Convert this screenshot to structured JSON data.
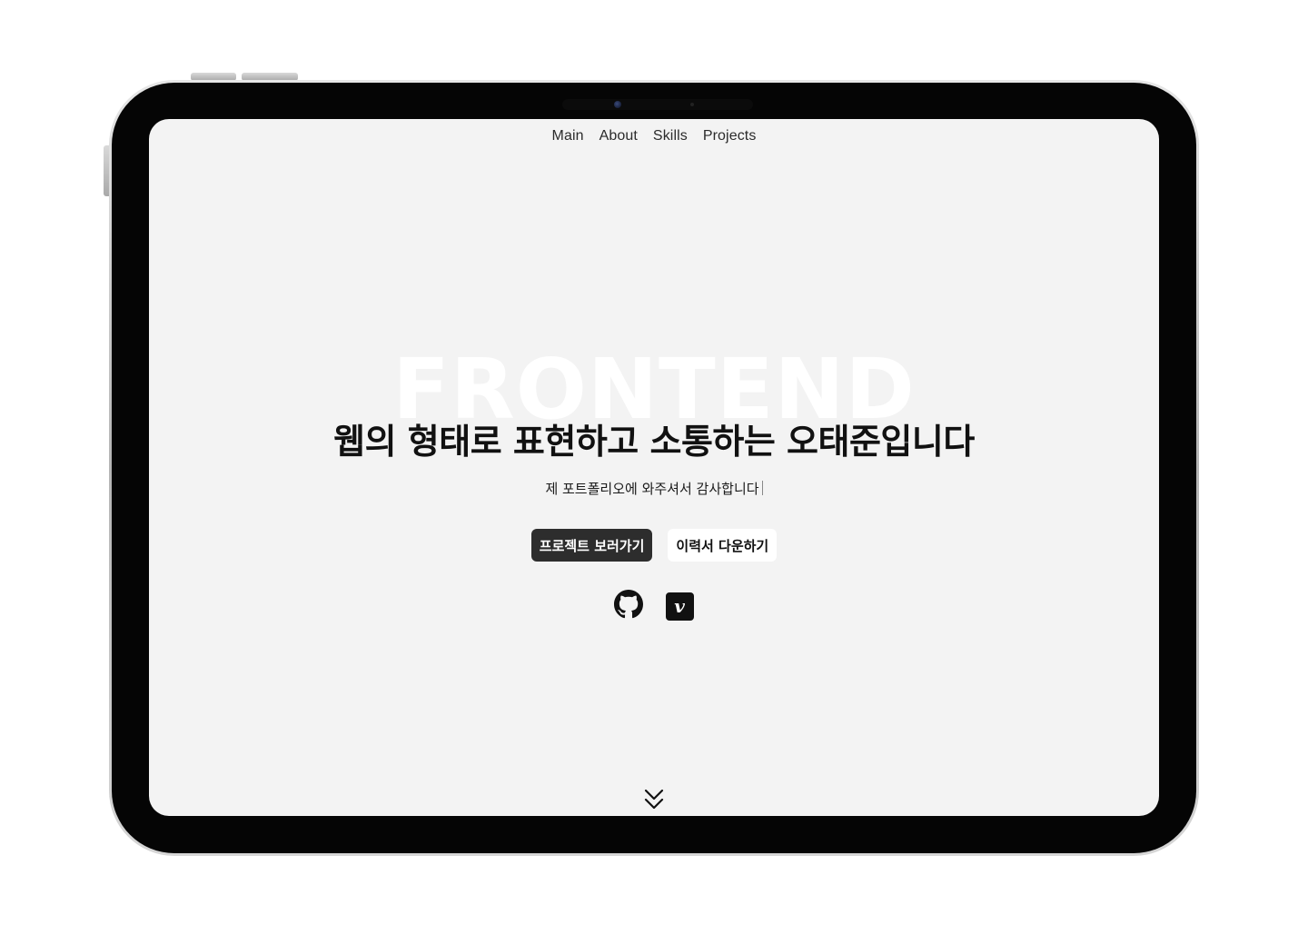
{
  "nav": {
    "items": [
      {
        "label": "Main"
      },
      {
        "label": "About"
      },
      {
        "label": "Skills"
      },
      {
        "label": "Projects"
      }
    ]
  },
  "hero": {
    "background_word": "FRONTEND",
    "headline": "웹의 형태로 표현하고 소통하는 오태준입니다",
    "subline": "제 포트폴리오에 와주셔서 감사합니다"
  },
  "actions": {
    "primary_label": "프로젝트 보러가기",
    "secondary_label": "이력서 다운하기"
  },
  "socials": [
    {
      "icon": "github-icon"
    },
    {
      "icon": "velog-icon",
      "glyph": "v"
    }
  ],
  "scroll": {
    "icon": "double-chevron-down-icon"
  },
  "colors": {
    "screen_bg": "#f3f3f3",
    "primary_button": "#2d2d2d",
    "text": "#111111"
  }
}
